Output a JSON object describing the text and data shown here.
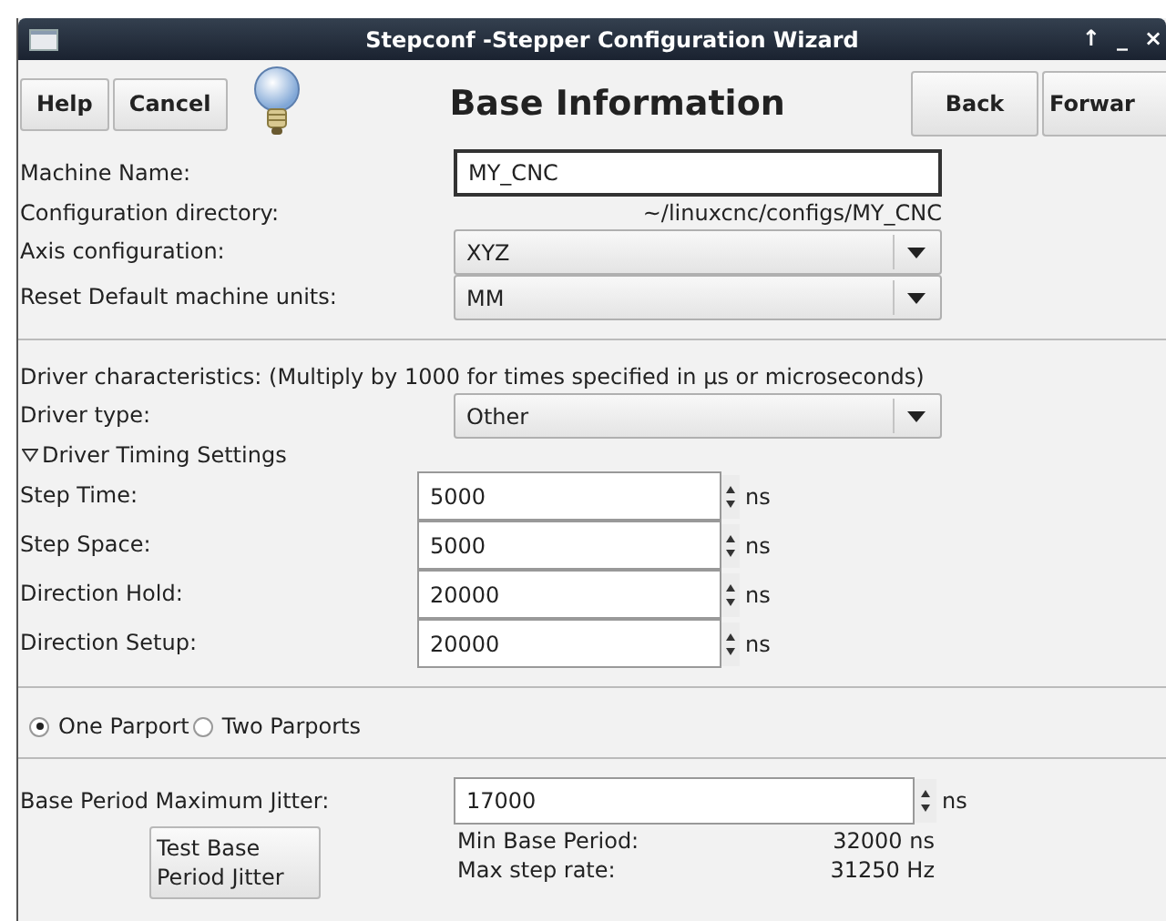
{
  "window": {
    "title": "Stepconf -Stepper Configuration Wizard",
    "controls": [
      "↑",
      "_",
      "×"
    ]
  },
  "header": {
    "left_buttons": [
      "Help",
      "Cancel"
    ],
    "title": "Base Information",
    "right_buttons": [
      "Back",
      "Forwar"
    ]
  },
  "machine_name": {
    "label": "Machine Name:",
    "value": "MY_CNC"
  },
  "config_dir": {
    "label": "Configuration directory:",
    "value": "~/linuxcnc/configs/MY_CNC"
  },
  "combos": [
    {
      "label": "Axis configuration:",
      "value": "XYZ"
    },
    {
      "label": "Reset Default machine units:",
      "value": "MM"
    }
  ],
  "driver_note": "Driver characteristics: (Multiply by 1000 for times specified in µs or microseconds)",
  "driver_type": {
    "label": "Driver type:",
    "value": "Other"
  },
  "timing": {
    "label": "Driver Timing Settings",
    "expanded": true,
    "rows": [
      {
        "label": "Step Time:",
        "value": "5000",
        "unit": "ns"
      },
      {
        "label": "Step Space:",
        "value": "5000",
        "unit": "ns"
      },
      {
        "label": "Direction Hold:",
        "value": "20000",
        "unit": "ns"
      },
      {
        "label": "Direction Setup:",
        "value": "20000",
        "unit": "ns"
      }
    ]
  },
  "parports": [
    {
      "label": "One Parport",
      "selected": true
    },
    {
      "label": "Two Parports",
      "selected": false
    }
  ],
  "jitter": {
    "label": "Base Period Maximum Jitter:",
    "value": "17000",
    "unit": "ns"
  },
  "test_button": "Test Base Period Jitter",
  "results": [
    {
      "label": "Min Base Period:",
      "value": "32000 ns"
    },
    {
      "label": "Max step rate:",
      "value": "31250 Hz"
    }
  ]
}
